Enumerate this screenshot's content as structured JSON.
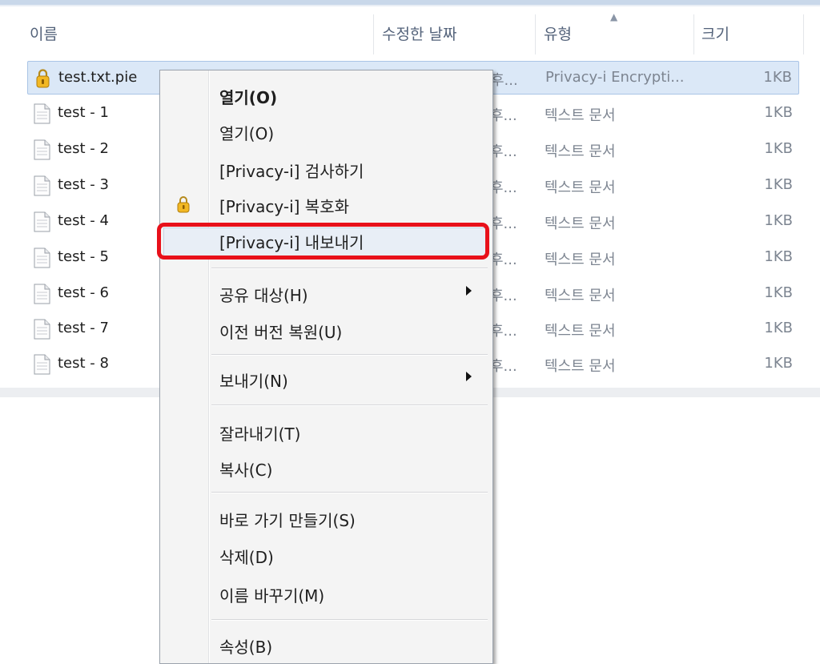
{
  "header": {
    "name": "이름",
    "date": "수정한 날짜",
    "type": "유형",
    "size": "크기"
  },
  "files": [
    {
      "name": "test.txt.pie",
      "date": "후...",
      "type": "Privacy-i Encrypti...",
      "size": "1KB",
      "icon": "lock-file-icon"
    },
    {
      "name": "test - 1",
      "date": "후...",
      "type": "텍스트 문서",
      "size": "1KB",
      "icon": "text-file-icon"
    },
    {
      "name": "test - 2",
      "date": "후...",
      "type": "텍스트 문서",
      "size": "1KB",
      "icon": "text-file-icon"
    },
    {
      "name": "test - 3",
      "date": "후...",
      "type": "텍스트 문서",
      "size": "1KB",
      "icon": "text-file-icon"
    },
    {
      "name": "test - 4",
      "date": "후...",
      "type": "텍스트 문서",
      "size": "1KB",
      "icon": "text-file-icon"
    },
    {
      "name": "test - 5",
      "date": "후...",
      "type": "텍스트 문서",
      "size": "1KB",
      "icon": "text-file-icon"
    },
    {
      "name": "test - 6",
      "date": "후...",
      "type": "텍스트 문서",
      "size": "1KB",
      "icon": "text-file-icon"
    },
    {
      "name": "test - 7",
      "date": "후...",
      "type": "텍스트 문서",
      "size": "1KB",
      "icon": "text-file-icon"
    },
    {
      "name": "test - 8",
      "date": "후...",
      "type": "텍스트 문서",
      "size": "1KB",
      "icon": "text-file-icon"
    }
  ],
  "menu": {
    "open_bold": "열기(O)",
    "open": "열기(O)",
    "scan": "[Privacy-i] 검사하기",
    "decrypt": "[Privacy-i] 복호화",
    "export": "[Privacy-i] 내보내기",
    "share": "공유 대상(H)",
    "restore": "이전 버전 복원(U)",
    "send_to": "보내기(N)",
    "cut": "잘라내기(T)",
    "copy": "복사(C)",
    "shortcut": "바로 가기 만들기(S)",
    "delete": "삭제(D)",
    "rename": "이름 바꾸기(M)",
    "properties": "속성(B)"
  },
  "colors": {
    "highlight": "#e8101a",
    "selection": "#dbe8f7"
  }
}
